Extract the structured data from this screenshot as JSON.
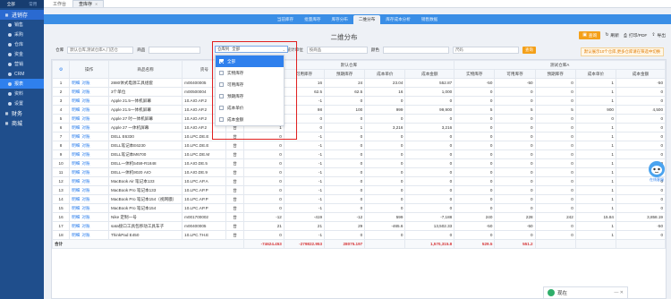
{
  "sidebar": {
    "top_left": "全部",
    "top_right": "常用",
    "items": [
      {
        "label": "进销存",
        "icon": "grid-icon",
        "type": "parent",
        "active": true
      },
      {
        "label": "销售",
        "icon": "sales-icon",
        "type": "sub"
      },
      {
        "label": "采购",
        "icon": "purchase-icon",
        "type": "sub"
      },
      {
        "label": "仓库",
        "icon": "warehouse-icon",
        "type": "sub"
      },
      {
        "label": "资金",
        "icon": "money-icon",
        "type": "sub"
      },
      {
        "label": "营销",
        "icon": "marketing-icon",
        "type": "sub"
      },
      {
        "label": "CRM",
        "icon": "crm-icon",
        "type": "sub"
      },
      {
        "label": "报表",
        "icon": "report-icon",
        "type": "sub",
        "selected": true
      },
      {
        "label": "资料",
        "icon": "data-icon",
        "type": "sub"
      },
      {
        "label": "设置",
        "icon": "settings-icon",
        "type": "sub"
      },
      {
        "label": "财务",
        "icon": "finance-icon",
        "type": "parent"
      },
      {
        "label": "商城",
        "icon": "shop-icon",
        "type": "parent"
      }
    ]
  },
  "tabs": [
    {
      "label": "工作台",
      "active": false
    },
    {
      "label": "查库存",
      "active": true
    }
  ],
  "subnav": [
    "当前库存",
    "批量库存",
    "库存分布",
    "二维分布",
    "库存成本分析",
    "销售数据"
  ],
  "subnav_active": 3,
  "page_title": "二维分布",
  "actions": {
    "query": "查询",
    "refresh": "刷新",
    "print": "打印/PDF",
    "export": "导出"
  },
  "filters": {
    "warehouse_label": "仓库",
    "warehouse_value": "默认仓库,测试仓库A,门店仓",
    "product_label": "商品",
    "product_value": "",
    "stats_value": "全部",
    "stats_prefix": "仓库列",
    "unit_label": "统计单位",
    "unit_value": "按商品",
    "color_label": "颜色",
    "color_value": "",
    "size_value": "尺码",
    "go": "查询"
  },
  "hint": "默认展示10个仓库,更多仓库请在筛选中切换",
  "dropdown": {
    "title": "全部",
    "options": [
      "全部",
      "实物库存",
      "可用库存",
      "预期库存",
      "成本单价",
      "成本金额"
    ]
  },
  "table": {
    "headers": [
      "",
      "操作",
      "商品名称",
      "货号",
      "单位",
      "实物库存",
      "可用库存",
      "预期库存",
      "成本单价",
      "成本金额",
      "实物库存",
      "可用库存",
      "预期库存",
      "成本单价",
      "成本金额"
    ],
    "group_headers": [
      "默认仓库",
      "测试仓库A"
    ],
    "rows": [
      [
        "1",
        "2880体式电源工具组套",
        "m00400005",
        "台",
        "18",
        "16",
        "24",
        "23.04",
        "552.87",
        "-50",
        "-50",
        "0",
        "1",
        "-50"
      ],
      [
        "2",
        "3个单位",
        "m00500004",
        "台",
        "62.5",
        "62.5",
        "62.5",
        "16",
        "1,000",
        "0",
        "0",
        "0",
        "1",
        "0"
      ],
      [
        "3",
        "Apple 21.5一体机屏幕",
        "10.AIO.AP.2",
        "台",
        "0",
        "-1",
        "0",
        "0",
        "0",
        "0",
        "0",
        "0",
        "1",
        "0"
      ],
      [
        "4",
        "Apple 21.5一体机屏幕",
        "10.AIO.AP.2",
        "台",
        "100",
        "98",
        "100",
        "999",
        "99,900",
        "5",
        "5",
        "5",
        "900",
        "4,500"
      ],
      [
        "5",
        "Apple 27 吋一体机屏幕",
        "10.AIO.AP.2",
        "台",
        "0",
        "0",
        "0",
        "0",
        "0",
        "0",
        "0",
        "0",
        "0",
        "0"
      ],
      [
        "6",
        "Apple 27 一体机屏幕",
        "10.AIO.AP.2",
        "台",
        "1",
        "0",
        "1",
        "3,216",
        "3,216",
        "0",
        "0",
        "0",
        "1",
        "0"
      ],
      [
        "7",
        "DELL E6330",
        "10.LPC.DE.E",
        "台",
        "0",
        "-1",
        "0",
        "0",
        "0",
        "0",
        "0",
        "0",
        "1",
        "0"
      ],
      [
        "8",
        "DELL笔记本E6230",
        "10.LPC.DE.E",
        "台",
        "0",
        "-1",
        "0",
        "0",
        "0",
        "0",
        "0",
        "0",
        "1",
        "0"
      ],
      [
        "9",
        "DELL笔记本M6700",
        "10.LPC.DE.M",
        "台",
        "0",
        "-1",
        "0",
        "0",
        "0",
        "0",
        "0",
        "0",
        "1",
        "0"
      ],
      [
        "10",
        "DELL一体机5459-R1848",
        "10.AIO.DE.5",
        "台",
        "0",
        "-1",
        "0",
        "0",
        "0",
        "0",
        "0",
        "0",
        "1",
        "0"
      ],
      [
        "11",
        "DELL一体机9020 AIO",
        "10.AIO.DE.9",
        "台",
        "0",
        "-1",
        "0",
        "0",
        "0",
        "0",
        "0",
        "0",
        "1",
        "0"
      ],
      [
        "12",
        "MacBook Air 笔记本133",
        "10.LPC.AP.A",
        "台",
        "0",
        "-1",
        "0",
        "0",
        "0",
        "0",
        "0",
        "0",
        "1",
        "0"
      ],
      [
        "13",
        "MacBook Pro 笔记本133",
        "10.LPC.AP.P",
        "台",
        "0",
        "-1",
        "0",
        "0",
        "0",
        "0",
        "0",
        "0",
        "1",
        "0"
      ],
      [
        "14",
        "MacBook Pro 笔记本154（视网膜）",
        "10.LPC.AP.P",
        "台",
        "0",
        "-1",
        "0",
        "0",
        "0",
        "0",
        "0",
        "0",
        "1",
        "0"
      ],
      [
        "15",
        "MacBook Pro 笔记本154",
        "10.LPC.AP.P",
        "台",
        "0",
        "-1",
        "0",
        "0",
        "0",
        "0",
        "0",
        "0",
        "1",
        "0"
      ],
      [
        "16",
        "Nike 定制一号",
        "m001700002",
        "台",
        "-12",
        "-419",
        "-12",
        "599",
        "-7,188",
        "240",
        "228",
        "242",
        "15.84",
        "3,858.19"
      ],
      [
        "17",
        "sata接口工具包移动工具车子",
        "m00400005",
        "台",
        "21",
        "21",
        "29",
        "-465.6",
        "13,502.33",
        "-50",
        "-50",
        "0",
        "1",
        "-50"
      ],
      [
        "18",
        "ThinkPad E450",
        "10.LPC.TH.E",
        "台",
        "0",
        "-1",
        "0",
        "0",
        "0",
        "0",
        "0",
        "0",
        "1",
        "0"
      ]
    ],
    "row_actions": [
      "明细",
      "对账"
    ],
    "footer": {
      "label": "合计",
      "values": [
        "-74624.453",
        "-279822.953",
        "28075.197",
        "",
        "1,570,315.8",
        "529.5",
        "551.2"
      ]
    }
  },
  "chat": {
    "label": "现在"
  },
  "mascot": {
    "label": "在线客服"
  },
  "colors": {
    "sidebar": "#1f4e8c",
    "subnav": "#3a8ee6",
    "accent": "#f4a019",
    "link": "#2f80ed",
    "highlight": "#e02020"
  }
}
